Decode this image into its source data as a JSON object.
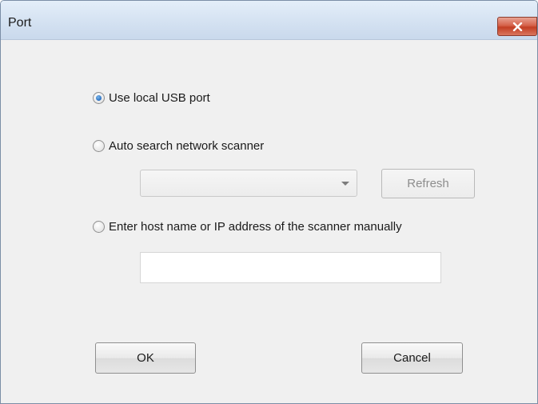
{
  "window": {
    "title": "Port"
  },
  "options": {
    "usb_label": "Use local USB port",
    "auto_search_label": "Auto search network scanner",
    "manual_label": "Enter host name or IP address of the scanner manually",
    "selected": "usb"
  },
  "scanner_select": {
    "value": ""
  },
  "refresh_label": "Refresh",
  "host_input": {
    "value": "",
    "placeholder": ""
  },
  "buttons": {
    "ok_label": "OK",
    "cancel_label": "Cancel"
  },
  "colors": {
    "dialog_bg": "#f0f0f0",
    "titlebar": "#d7e4f3",
    "close_button": "#c94a30",
    "radio_selected": "#2a6fc1"
  },
  "icons": {
    "close": "close-x-icon",
    "dropdown": "chevron-down-icon"
  }
}
